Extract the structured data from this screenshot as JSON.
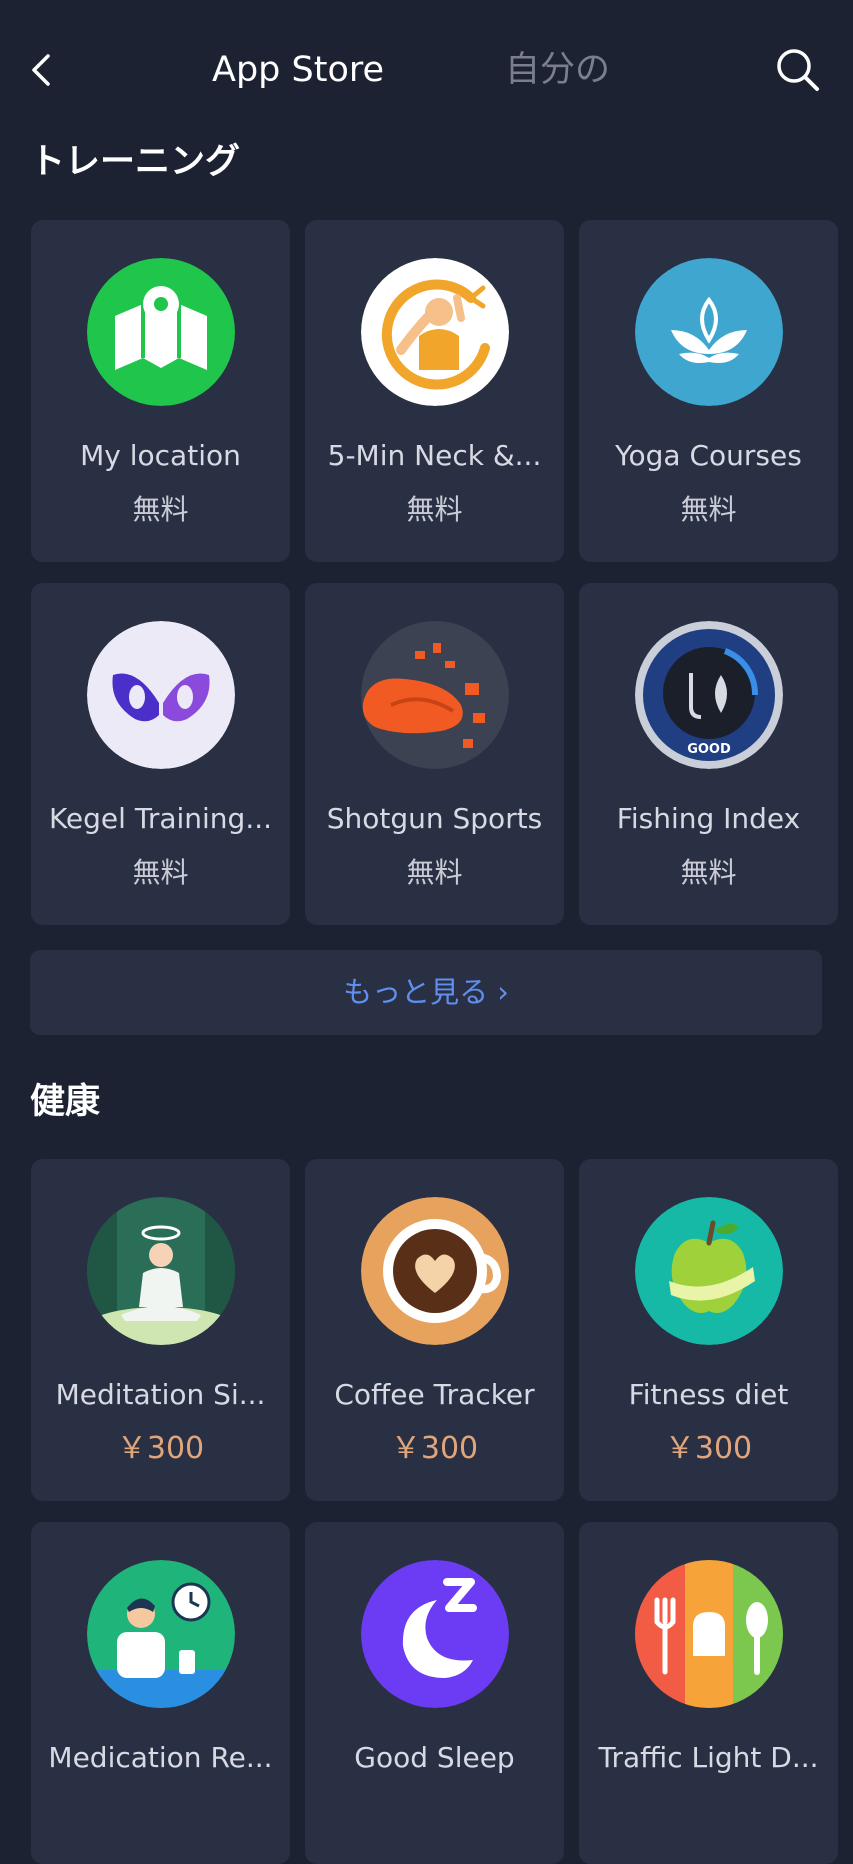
{
  "header": {
    "tab_active": "App Store",
    "tab_inactive": "自分の",
    "back_icon": "chevron-left-icon",
    "search_icon": "search-icon"
  },
  "sections": [
    {
      "title": "トレーニング",
      "apps": [
        {
          "name": "My location",
          "price": "無料",
          "icon": "map-pin-icon"
        },
        {
          "name": "5-Min Neck &...",
          "price": "無料",
          "icon": "neck-stretch-icon"
        },
        {
          "name": "Yoga Courses",
          "price": "無料",
          "icon": "lotus-icon"
        },
        {
          "name": "Kegel Training...",
          "price": "無料",
          "icon": "butterfly-icon"
        },
        {
          "name": "Shotgun Sports",
          "price": "無料",
          "icon": "clay-target-icon"
        },
        {
          "name": "Fishing Index",
          "price": "無料",
          "icon": "fishing-gauge-icon",
          "badge": "GOOD"
        }
      ],
      "more_label": "もっと見る ›"
    },
    {
      "title": "健康",
      "apps": [
        {
          "name": "Meditation Si...",
          "price": "￥300",
          "icon": "meditation-icon"
        },
        {
          "name": "Coffee Tracker",
          "price": "￥300",
          "icon": "coffee-cup-icon"
        },
        {
          "name": "Fitness diet",
          "price": "￥300",
          "icon": "apple-tape-icon"
        },
        {
          "name": "Medication Re...",
          "price": "",
          "icon": "medication-reminder-icon"
        },
        {
          "name": "Good Sleep",
          "price": "",
          "icon": "moon-sleep-icon"
        },
        {
          "name": "Traffic Light D...",
          "price": "",
          "icon": "diet-utensils-icon"
        }
      ]
    }
  ],
  "colors": {
    "background": "#1d2233",
    "card": "#2a3043",
    "link": "#5f8ff0",
    "paid_price": "#e0a57a"
  }
}
